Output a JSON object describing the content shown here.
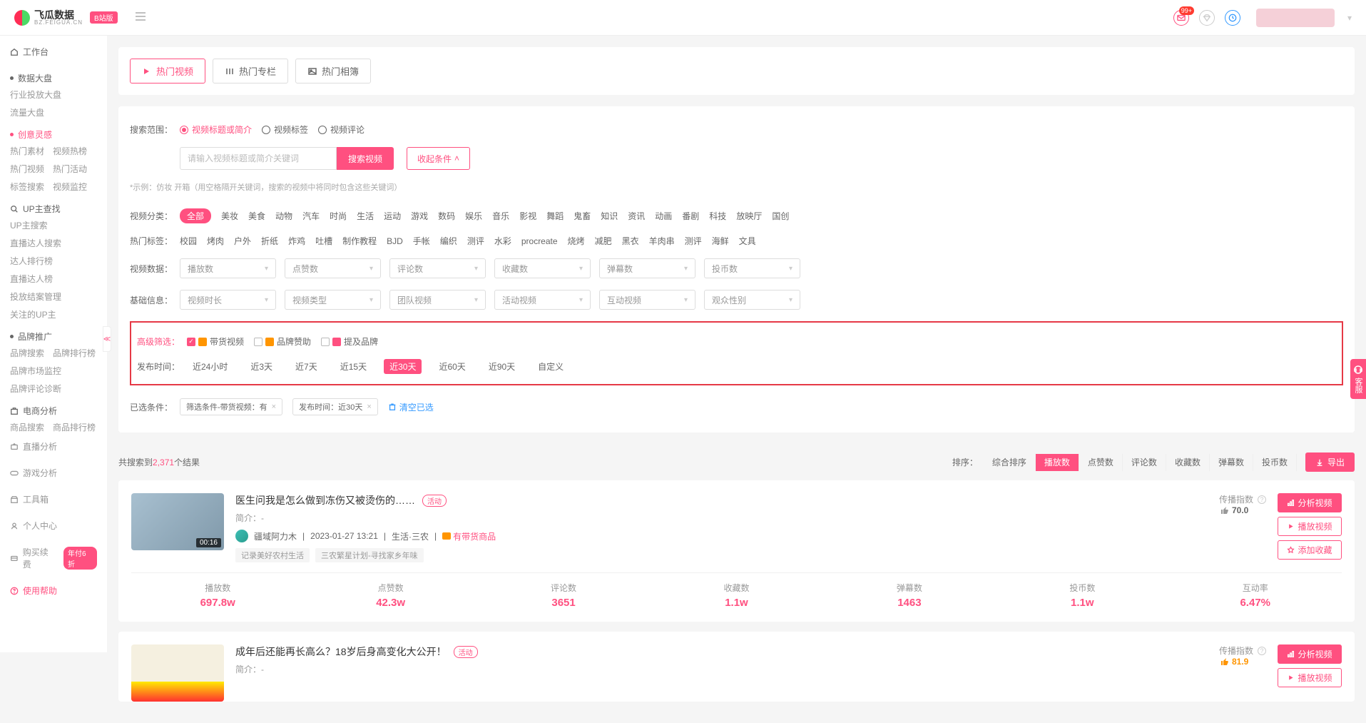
{
  "logo": {
    "name": "飞瓜数据",
    "sub": "BZ.FEIGUA.CN",
    "badge": "B站版",
    "notif": "99+"
  },
  "sidebar": {
    "workbench": "工作台",
    "dashboard": {
      "title": "数据大盘",
      "links": [
        "行业投放大盘",
        "流量大盘"
      ]
    },
    "creative": {
      "title": "创意灵感",
      "links": [
        "热门素材",
        "视频热榜",
        "热门视频",
        "热门活动",
        "标签搜索",
        "视频监控"
      ]
    },
    "upmaster": {
      "title": "UP主查找",
      "links": [
        "UP主搜索",
        "直播达人搜索",
        "达人排行榜",
        "直播达人榜",
        "投放结案管理",
        "关注的UP主"
      ]
    },
    "brand": {
      "title": "品牌推广",
      "links": [
        "品牌搜索",
        "品牌排行榜",
        "品牌市场监控",
        "品牌评论诊断"
      ]
    },
    "ecom": {
      "title": "电商分析",
      "links": [
        "商品搜索",
        "商品排行榜"
      ]
    },
    "live": "直播分析",
    "game": "游戏分析",
    "tools": "工具箱",
    "personal": "个人中心",
    "buy": "购买续费",
    "buy_badge": "年付6折",
    "help": "使用帮助"
  },
  "top_tabs": [
    "热门视频",
    "热门专栏",
    "热门相簿"
  ],
  "filters": {
    "scope_label": "搜索范围：",
    "scope_opts": [
      "视频标题或简介",
      "视频标签",
      "视频评论"
    ],
    "search_placeholder": "请输入视频标题或简介关键词",
    "search_btn": "搜索视频",
    "collapse_btn": "收起条件",
    "hint": "*示例：仿妆 开箱（用空格隔开关键词，搜索的视频中将同时包含这些关键词）",
    "category_label": "视频分类：",
    "categories": [
      "全部",
      "美妆",
      "美食",
      "动物",
      "汽车",
      "时尚",
      "生活",
      "运动",
      "游戏",
      "数码",
      "娱乐",
      "音乐",
      "影视",
      "舞蹈",
      "鬼畜",
      "知识",
      "资讯",
      "动画",
      "番剧",
      "科技",
      "放映厅",
      "国创"
    ],
    "tags_label": "热门标签：",
    "tags": [
      "校园",
      "烤肉",
      "户外",
      "折纸",
      "炸鸡",
      "吐槽",
      "制作教程",
      "BJD",
      "手帐",
      "编织",
      "测评",
      "水彩",
      "procreate",
      "烧烤",
      "减肥",
      "黑衣",
      "羊肉串",
      "测评",
      "海鲜",
      "文具"
    ],
    "metrics_label": "视频数据：",
    "metrics": [
      "播放数",
      "点赞数",
      "评论数",
      "收藏数",
      "弹幕数",
      "投币数"
    ],
    "basic_label": "基础信息：",
    "basics": [
      "视频时长",
      "视频类型",
      "团队视频",
      "活动视频",
      "互动视频",
      "观众性别"
    ],
    "advanced_label": "高级筛选：",
    "adv_opts": [
      "带货视频",
      "品牌赞助",
      "提及品牌"
    ],
    "time_label": "发布时间：",
    "time_opts": [
      "近24小时",
      "近3天",
      "近7天",
      "近15天",
      "近30天",
      "近60天",
      "近90天",
      "自定义"
    ],
    "selected_label": "已选条件：",
    "sel_tags": [
      "筛选条件-带货视频：有",
      "发布时间：近30天"
    ],
    "clear": "清空已选"
  },
  "results": {
    "count_prefix": "共搜索到",
    "count": "2,371",
    "count_suffix": "个结果",
    "sort_label": "排序：",
    "sort_opts": [
      "综合排序",
      "播放数",
      "点赞数",
      "评论数",
      "收藏数",
      "弹幕数",
      "投币数"
    ],
    "export": "导出"
  },
  "cards": [
    {
      "title": "医生问我是怎么做到冻伤又被烫伤的……",
      "activity": "活动",
      "desc": "简介：-",
      "author": "疆域阿力木",
      "date": "2023-01-27 13:21",
      "cat": "生活·三农",
      "goods": "有带货商品",
      "tags": [
        "记录美好农村生活",
        "三农繁星计划-寻找家乡年味"
      ],
      "duration": "00:16",
      "spread_label": "传播指数",
      "score": "70.0",
      "btns": [
        "分析视频",
        "播放视频",
        "添加收藏"
      ],
      "stats_labels": [
        "播放数",
        "点赞数",
        "评论数",
        "收藏数",
        "弹幕数",
        "投币数",
        "互动率"
      ],
      "stats_vals": [
        "697.8w",
        "42.3w",
        "3651",
        "1.1w",
        "1463",
        "1.1w",
        "6.47%"
      ]
    },
    {
      "title": "成年后还能再长高么？18岁后身高变化大公开！",
      "activity": "活动",
      "desc": "简介：-",
      "duration": "",
      "spread_label": "传播指数",
      "score": "81.9",
      "btns": [
        "分析视频",
        "播放视频"
      ]
    }
  ],
  "float_service": "客服"
}
